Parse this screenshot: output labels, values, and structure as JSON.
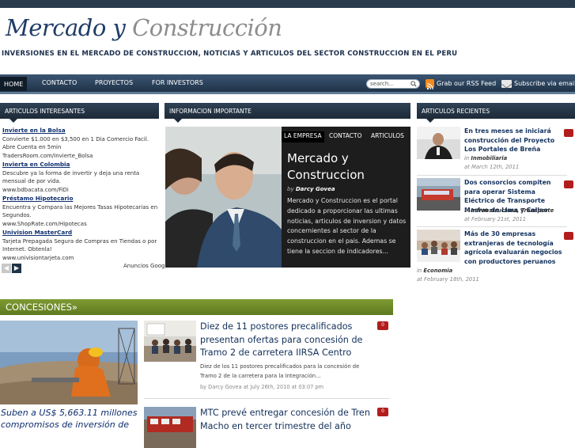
{
  "site": {
    "logo_part1": "Mercado y",
    "logo_part2": "Construcción",
    "tagline": "Inversiones en el mercado de construccion, noticias y articulos del sector construccion en el peru"
  },
  "nav": {
    "items": [
      "HOME",
      "CONTACTO",
      "PROYECTOS",
      "FOR INVESTORS"
    ],
    "search_placeholder": "search...",
    "rss_label": "Grab our RSS Feed",
    "email_label": "Subscribe via email"
  },
  "colors": {
    "brand_dark": "#1f3c66",
    "nav_bg": "#2a3b4d",
    "accent_green": "#6e8a28",
    "badge_red": "#b31d1d"
  },
  "left_box": {
    "heading": "ARTICULOS INTERESANTES",
    "ads": [
      {
        "title": "Invierte en la Bolsa",
        "desc": "Convierte $1.000 en $3,500 en 1 Dia Comercio Facil. Abre Cuenta en 5min",
        "url": "TradersRoom.com/Invierte_Bolsa"
      },
      {
        "title": "Invierta en Colombia",
        "desc": "Descubre ya la forma de invertir y deja una renta mensual de por vida.",
        "url": "www.bdbacata.com/FiDi"
      },
      {
        "title": "Préstamo Hipotecario",
        "desc": "Encuentra y Compara las Mejores Tasas Hipotecarias en Segundos.",
        "url": "www.ShopRate.com/Hipotecas"
      },
      {
        "title": "Univision MasterCard",
        "desc": "Tarjeta Prepagada Segura de Compras en Tiendas o por Internet. Obtenla!",
        "url": "www.univisiontarjeta.com"
      }
    ],
    "ads_by": "Anuncios Google"
  },
  "featured": {
    "heading": "INFORMACION IMPORTANTE",
    "tabs": [
      "LA EMPRESA",
      "CONTACTO",
      "ARTICULOS"
    ],
    "title": "Mercado y Construccion",
    "by_prefix": "by",
    "author": "Darcy Govea",
    "body": "Mercado y Construccion es el portal dedicado a proporcionar las ultimas noticias, articulos de inversion y datos concernientes al sector de la construccion en el pais. Ademas se tiene la seccion de indicadores..."
  },
  "recent": {
    "heading": "ARTICULOS RECIENTES",
    "items": [
      {
        "title": "En tres meses se iniciará construcción del Proyecto Los Portales de Breña",
        "cat_prefix": "in",
        "category": "Inmobiliaria",
        "date": "at March 12th, 2011"
      },
      {
        "title": "Dos consorcios compiten para operar Sistema Eléctrico de Transporte Masivo de Lima y Callao",
        "cat_prefix": "in",
        "category": "Infraestructura, Transporte",
        "date": "at February 21st, 2011"
      },
      {
        "title": "Más de 30 empresas extranjeras de tecnología agrícola evaluarán negocios con productores peruanos",
        "cat_prefix": "in",
        "category": "Economia",
        "date": "at February 18th, 2011"
      }
    ]
  },
  "concesiones": {
    "heading": "CONCESIONES»",
    "feature_caption": "Suben a US$ 5,663.11 millones compromisos de inversión de",
    "articles": [
      {
        "title": "Diez de 11 postores precalificados presentan ofertas para concesión de Tramo 2 de carretera IIRSA Centro",
        "excerpt": "Diez de los 11 postores precalificados para la concesión de Tramo 2 de la carretera para la Integración...",
        "meta": "by Darcy Govea at July 26th, 2010 at 03:07 pm",
        "comments": "0"
      },
      {
        "title": "MTC prevé entregar concesión de Tren Macho en tercer trimestre del año",
        "comments": "0"
      }
    ]
  }
}
